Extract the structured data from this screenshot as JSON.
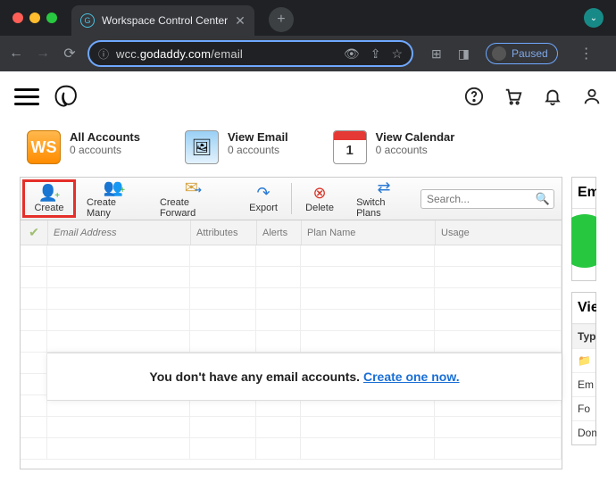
{
  "browser": {
    "tab_title": "Workspace Control Center",
    "url_display_prefix": "wcc.",
    "url_display_domain": "godaddy.com",
    "url_display_path": "/email",
    "paused_label": "Paused"
  },
  "header": {},
  "summary": {
    "accounts": {
      "title": "All Accounts",
      "sub": "0 accounts"
    },
    "email": {
      "title": "View Email",
      "sub": "0 accounts"
    },
    "calendar": {
      "title": "View Calendar",
      "sub": "0 accounts",
      "day": "1"
    }
  },
  "toolbar": {
    "create": "Create",
    "create_many": "Create Many",
    "create_forward": "Create Forward",
    "export": "Export",
    "delete": "Delete",
    "switch_plans": "Switch Plans",
    "search_placeholder": "Search..."
  },
  "columns": {
    "email": "Email Address",
    "attributes": "Attributes",
    "alerts": "Alerts",
    "plan": "Plan Name",
    "usage": "Usage"
  },
  "empty_state": {
    "text": "You don't have any email accounts. ",
    "link": "Create one now."
  },
  "side": {
    "block1_title": "Em",
    "block2_title": "Vie",
    "type_header": "Typ",
    "rows": [
      "Em",
      "Fo",
      "Dom"
    ]
  }
}
